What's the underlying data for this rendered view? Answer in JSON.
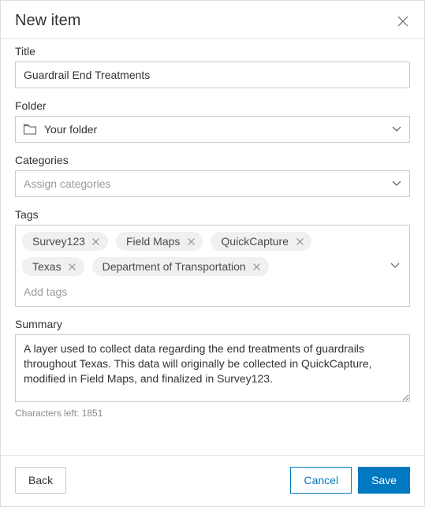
{
  "dialog": {
    "title": "New item"
  },
  "fields": {
    "title": {
      "label": "Title",
      "value": "Guardrail End Treatments"
    },
    "folder": {
      "label": "Folder",
      "selected": "Your folder"
    },
    "categories": {
      "label": "Categories",
      "placeholder": "Assign categories"
    },
    "tags": {
      "label": "Tags",
      "items": [
        "Survey123",
        "Field Maps",
        "QuickCapture",
        "Texas",
        "Department of Transportation"
      ],
      "placeholder": "Add tags"
    },
    "summary": {
      "label": "Summary",
      "value": "A layer used to collect data regarding the end treatments of guardrails throughout Texas. This data will originally be collected in QuickCapture, modified in Field Maps, and finalized in Survey123.",
      "helper": "Characters left: 1851"
    }
  },
  "footer": {
    "back": "Back",
    "cancel": "Cancel",
    "save": "Save"
  }
}
